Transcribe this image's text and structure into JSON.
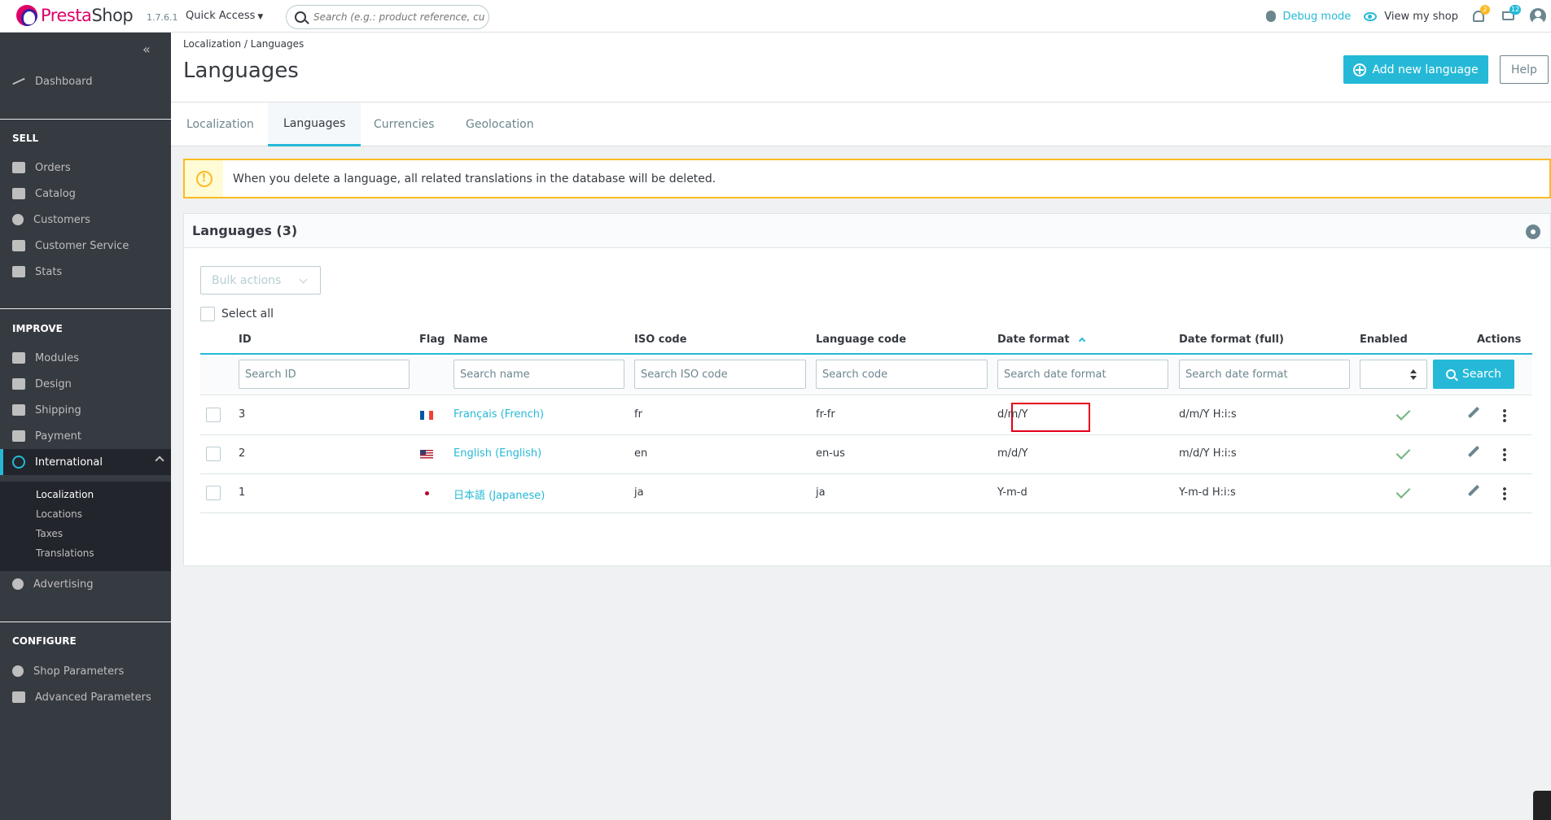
{
  "header": {
    "logo_prefix": "Presta",
    "logo_suffix": "Shop",
    "version": "1.7.6.1",
    "quick_access": "Quick Access",
    "search_placeholder": "Search (e.g.: product reference, custome",
    "debug_mode": "Debug mode",
    "view_shop": "View my shop",
    "notifications_count": "2",
    "orders_count": "12"
  },
  "sidebar": {
    "dashboard": "Dashboard",
    "sections": {
      "sell": "SELL",
      "improve": "IMPROVE",
      "configure": "CONFIGURE"
    },
    "sell_items": [
      "Orders",
      "Catalog",
      "Customers",
      "Customer Service",
      "Stats"
    ],
    "improve_items": [
      "Modules",
      "Design",
      "Shipping",
      "Payment",
      "International"
    ],
    "international_sub": [
      "Localization",
      "Locations",
      "Taxes",
      "Translations"
    ],
    "advertising": "Advertising",
    "configure_items": [
      "Shop Parameters",
      "Advanced Parameters"
    ]
  },
  "page": {
    "breadcrumb_parent": "Localization",
    "breadcrumb_current": "Languages",
    "title": "Languages",
    "add_button": "Add new language",
    "help_button": "Help"
  },
  "tabs": [
    "Localization",
    "Languages",
    "Currencies",
    "Geolocation"
  ],
  "alert": "When you delete a language, all related translations in the database will be deleted.",
  "grid": {
    "title": "Languages (3)",
    "bulk_actions": "Bulk actions",
    "select_all": "Select all",
    "columns": {
      "id": "ID",
      "flag": "Flag",
      "name": "Name",
      "iso": "ISO code",
      "lang_code": "Language code",
      "date_format": "Date format",
      "date_full": "Date format (full)",
      "enabled": "Enabled",
      "actions": "Actions"
    },
    "filters": {
      "id": "Search ID",
      "name": "Search name",
      "iso": "Search ISO code",
      "code": "Search code",
      "date": "Search date format",
      "date_full": "Search date format",
      "search_button": "Search"
    },
    "rows": [
      {
        "id": "3",
        "flag": "fr",
        "name": "Français (French)",
        "iso": "fr",
        "code": "fr-fr",
        "date": "d/m/Y",
        "date_full": "d/m/Y H:i:s",
        "enabled": true
      },
      {
        "id": "2",
        "flag": "us",
        "name": "English (English)",
        "iso": "en",
        "code": "en-us",
        "date": "m/d/Y",
        "date_full": "m/d/Y H:i:s",
        "enabled": true
      },
      {
        "id": "1",
        "flag": "jp",
        "name": "日本語 (Japanese)",
        "iso": "ja",
        "code": "ja",
        "date": "Y-m-d",
        "date_full": "Y-m-d H:i:s",
        "enabled": true
      }
    ]
  },
  "colors": {
    "accent": "#25b9d7",
    "brand": "#df0067",
    "warning": "#fbbb22",
    "success": "#70b580",
    "sidebar": "#363a41"
  }
}
